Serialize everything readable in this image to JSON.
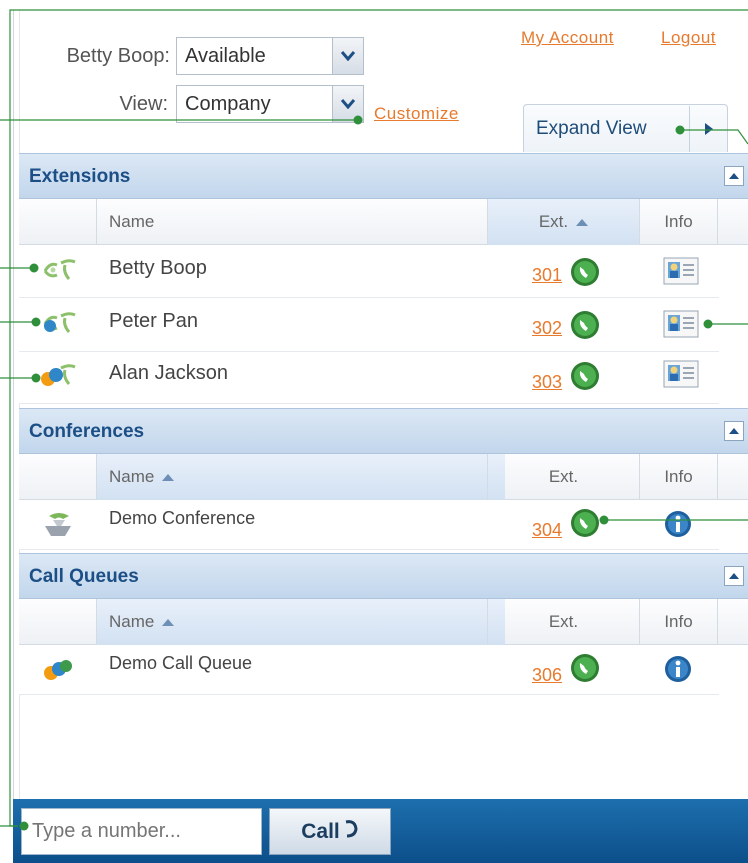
{
  "header": {
    "user_name_label": "Betty Boop:",
    "status_value": "Available",
    "view_label": "View:",
    "view_value": "Company",
    "customize_link": "Customize",
    "my_account_link": "My Account",
    "logout_link": "Logout",
    "expand_view_label": "Expand View"
  },
  "extensions": {
    "title": "Extensions",
    "columns": {
      "name": "Name",
      "ext": "Ext.",
      "info": "Info"
    },
    "rows": [
      {
        "name": "Betty Boop",
        "ext": "301",
        "icon": "extension-available-icon"
      },
      {
        "name": "Peter Pan",
        "ext": "302",
        "icon": "extension-busy-icon"
      },
      {
        "name": "Alan Jackson",
        "ext": "303",
        "icon": "extension-away-icon"
      }
    ]
  },
  "conferences": {
    "title": "Conferences",
    "columns": {
      "name": "Name",
      "ext": "Ext.",
      "info": "Info"
    },
    "rows": [
      {
        "name": "Demo Conference",
        "ext": "304",
        "icon": "conference-icon"
      }
    ]
  },
  "call_queues": {
    "title": "Call Queues",
    "columns": {
      "name": "Name",
      "ext": "Ext.",
      "info": "Info"
    },
    "rows": [
      {
        "name": "Demo Call Queue",
        "ext": "306",
        "icon": "call-queue-icon"
      }
    ]
  },
  "dialer": {
    "placeholder": "Type a number...",
    "call_label": "Call"
  },
  "colors": {
    "link": "#e87a2e",
    "section_title": "#1b4f86",
    "bottom_bar": "#0c4f8a",
    "callout": "#2f8f3a"
  }
}
